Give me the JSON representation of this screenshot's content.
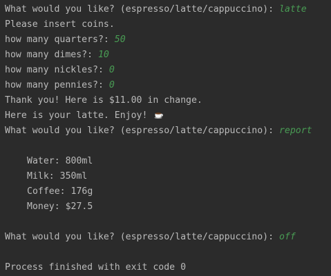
{
  "console": {
    "lines": [
      {
        "type": "prompt",
        "text": "What would you like? (espresso/latte/cappuccino): ",
        "input": "latte"
      },
      {
        "type": "text",
        "text": "Please insert coins."
      },
      {
        "type": "prompt",
        "text": "how many quarters?: ",
        "input": "50"
      },
      {
        "type": "prompt",
        "text": "how many dimes?: ",
        "input": "10"
      },
      {
        "type": "prompt",
        "text": "how many nickles?: ",
        "input": "0"
      },
      {
        "type": "prompt",
        "text": "how many pennies?: ",
        "input": "0"
      },
      {
        "type": "text",
        "text": "Thank you! Here is $11.00 in change."
      },
      {
        "type": "icon-text",
        "text": "Here is your latte. Enjoy! ",
        "icon": "coffee-cup-icon"
      },
      {
        "type": "prompt",
        "text": "What would you like? (espresso/latte/cappuccino): ",
        "input": "report"
      },
      {
        "type": "blank"
      },
      {
        "type": "report",
        "text": "Water: 800ml"
      },
      {
        "type": "report",
        "text": "Milk: 350ml"
      },
      {
        "type": "report",
        "text": "Coffee: 176g"
      },
      {
        "type": "report",
        "text": "Money: $27.5"
      },
      {
        "type": "blank"
      },
      {
        "type": "prompt",
        "text": "What would you like? (espresso/latte/cappuccino): ",
        "input": "off"
      },
      {
        "type": "blank"
      },
      {
        "type": "text",
        "text": "Process finished with exit code 0"
      }
    ]
  },
  "colors": {
    "background": "#2b2b2b",
    "output_text": "#bbbbbb",
    "user_input": "#499c54"
  }
}
